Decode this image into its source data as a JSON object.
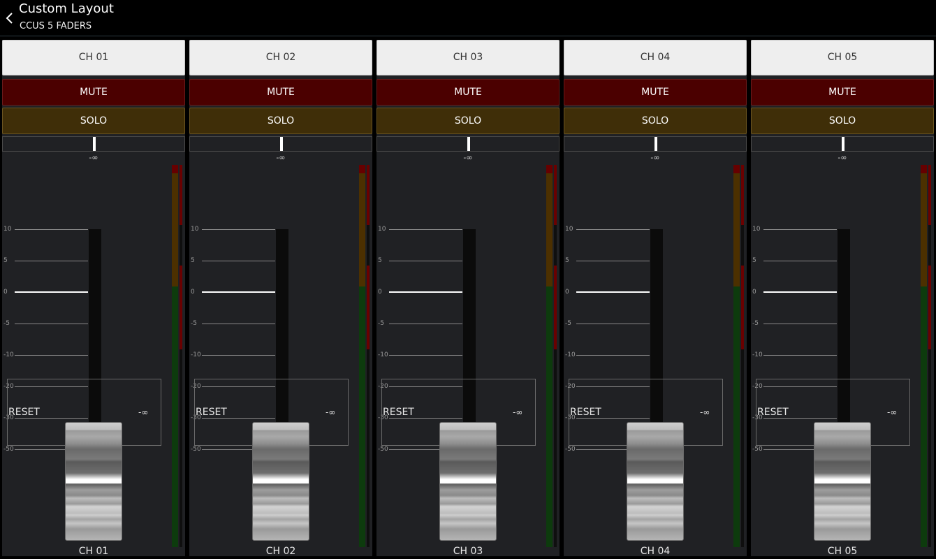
{
  "header": {
    "title": "Custom Layout",
    "subtitle": "CCUS 5 FADERS"
  },
  "scale_labels": [
    "10",
    "5",
    "0",
    "-5",
    "-10",
    "-20",
    "-30",
    "-50"
  ],
  "strips": [
    {
      "channel_button": "CH 01",
      "mute": "MUTE",
      "solo": "SOLO",
      "pan_value": "-∞",
      "reset": "RESET",
      "fader_value": "-∞",
      "name": "CH 01"
    },
    {
      "channel_button": "CH 02",
      "mute": "MUTE",
      "solo": "SOLO",
      "pan_value": "-∞",
      "reset": "RESET",
      "fader_value": "-∞",
      "name": "CH 02"
    },
    {
      "channel_button": "CH 03",
      "mute": "MUTE",
      "solo": "SOLO",
      "pan_value": "-∞",
      "reset": "RESET",
      "fader_value": "-∞",
      "name": "CH 03"
    },
    {
      "channel_button": "CH 04",
      "mute": "MUTE",
      "solo": "SOLO",
      "pan_value": "-∞",
      "reset": "RESET",
      "fader_value": "-∞",
      "name": "CH 04"
    },
    {
      "channel_button": "CH 05",
      "mute": "MUTE",
      "solo": "SOLO",
      "pan_value": "-∞",
      "reset": "RESET",
      "fader_value": "-∞",
      "name": "CH 05"
    }
  ],
  "colors": {
    "background": "#000000",
    "strip_bg": "#202124",
    "mute": "#4b0000",
    "solo": "#3f2e08",
    "channel_button": "#eeeeee",
    "meter_green": "#0d3b0d",
    "meter_amber": "#4c3000",
    "meter_red": "#660000"
  }
}
